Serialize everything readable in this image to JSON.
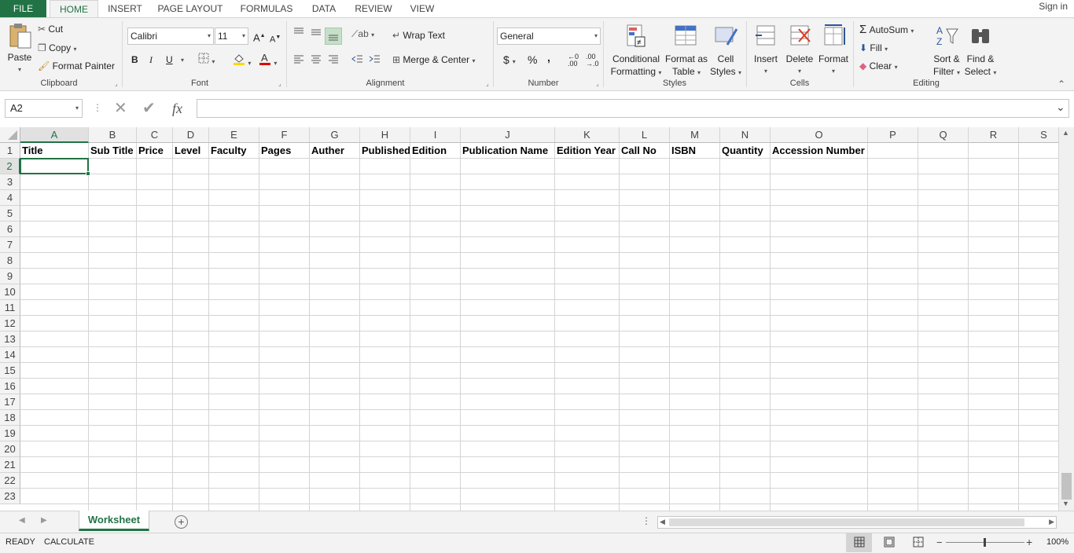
{
  "ribbon_tabs": [
    "FILE",
    "HOME",
    "INSERT",
    "PAGE LAYOUT",
    "FORMULAS",
    "DATA",
    "REVIEW",
    "VIEW"
  ],
  "active_tab": "HOME",
  "sign_in": "Sign in",
  "clipboard": {
    "paste": "Paste",
    "cut": "Cut",
    "copy": "Copy",
    "format_painter": "Format Painter",
    "label": "Clipboard"
  },
  "font": {
    "name": "Calibri",
    "size": "11",
    "bold": "B",
    "italic": "I",
    "underline": "U",
    "label": "Font"
  },
  "alignment": {
    "wrap_text": "Wrap Text",
    "merge_center": "Merge & Center",
    "label": "Alignment"
  },
  "number": {
    "format": "General",
    "currency": "$",
    "percent": "%",
    "comma": ",",
    "label": "Number"
  },
  "styles": {
    "conditional_1": "Conditional",
    "conditional_2": "Formatting",
    "format_table_1": "Format as",
    "format_table_2": "Table",
    "cell_styles_1": "Cell",
    "cell_styles_2": "Styles",
    "label": "Styles"
  },
  "cells": {
    "insert": "Insert",
    "delete": "Delete",
    "format": "Format",
    "label": "Cells"
  },
  "editing": {
    "autosum": "AutoSum",
    "fill": "Fill",
    "clear": "Clear",
    "sort_1": "Sort &",
    "sort_2": "Filter",
    "find_1": "Find &",
    "find_2": "Select",
    "label": "Editing"
  },
  "name_box": "A2",
  "fx_label": "fx",
  "formula_value": "",
  "columns": [
    "A",
    "B",
    "C",
    "D",
    "E",
    "F",
    "G",
    "H",
    "I",
    "J",
    "K",
    "L",
    "M",
    "N",
    "O",
    "P",
    "Q",
    "R",
    "S"
  ],
  "rows": [
    "1",
    "2",
    "3",
    "4",
    "5",
    "6",
    "7",
    "8",
    "9",
    "10",
    "11",
    "12",
    "13",
    "14",
    "15",
    "16",
    "17",
    "18",
    "19",
    "20",
    "21",
    "22",
    "23"
  ],
  "header_row": [
    "Title",
    "Sub Title",
    "Price",
    "Level",
    "Faculty",
    "Pages",
    "Auther",
    "Published",
    "Edition",
    "Publication Name",
    "Edition Year",
    "Call No",
    "ISBN",
    "Quantity",
    "Accession Number",
    "",
    "",
    "",
    ""
  ],
  "selected_cell": "A2",
  "sheet_tabs": [
    "Worksheet"
  ],
  "status": {
    "ready": "READY",
    "calculate": "CALCULATE",
    "zoom": "100%"
  },
  "colors": {
    "accent": "#217346",
    "ribbon_bg": "#f3f3f3",
    "grid": "#d4d4d4"
  }
}
